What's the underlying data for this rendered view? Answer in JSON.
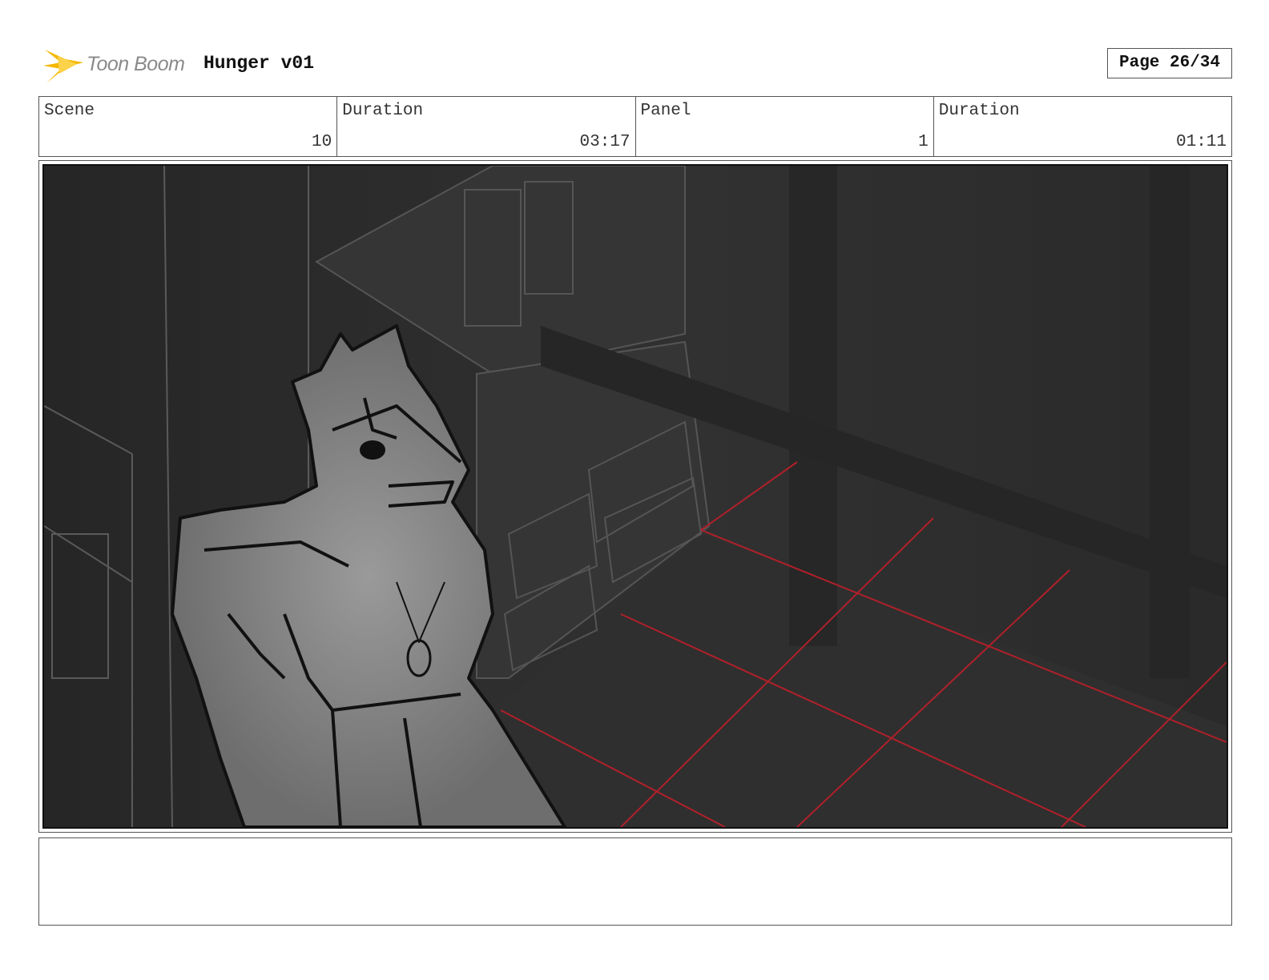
{
  "header": {
    "logo_text": "Toon Boom",
    "project_title": "Hunger v01",
    "page_label": "Page 26/34"
  },
  "info": {
    "scene_label": "Scene",
    "scene_value": "10",
    "scene_duration_label": "Duration",
    "scene_duration_value": "03:17",
    "panel_label": "Panel",
    "panel_value": "1",
    "panel_duration_label": "Duration",
    "panel_duration_value": "01:11"
  },
  "notes": {
    "text": ""
  },
  "colors": {
    "logo_star": "#f5b800",
    "grid_lines": "#b0202a",
    "panel_background": "#2c2c2c"
  }
}
